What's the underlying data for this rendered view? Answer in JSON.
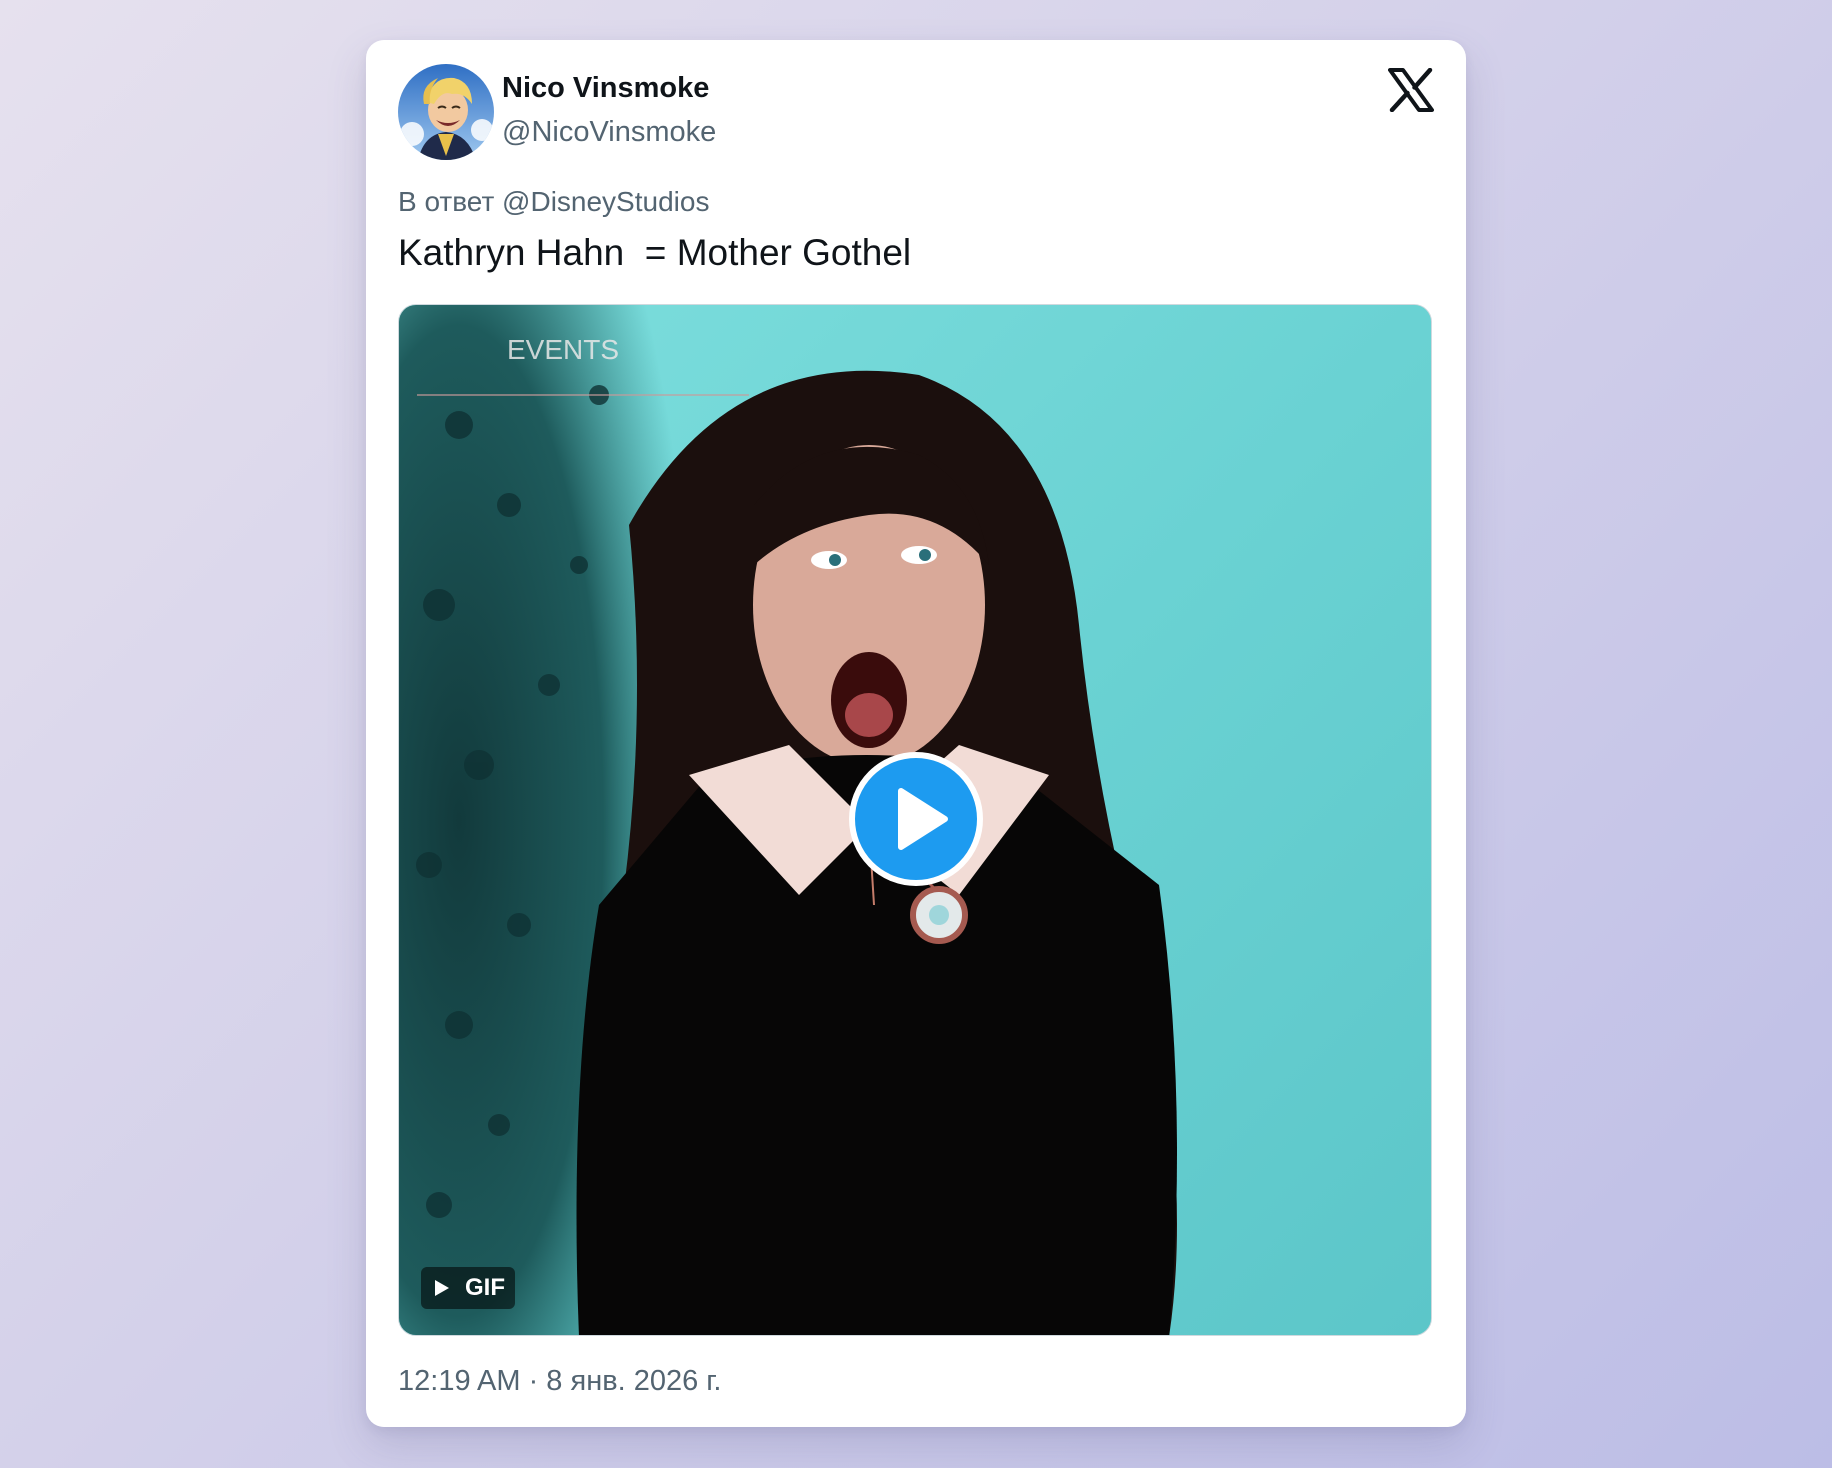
{
  "author": {
    "name": "Nico Vinsmoke",
    "handle": "@NicoVinsmoke",
    "avatar_icon": "anime-character-avatar"
  },
  "brand": {
    "logo_icon": "x-logo-icon"
  },
  "reply": {
    "prefix": "В ответ",
    "mention": "@DisneyStudios"
  },
  "tweet": {
    "text": "Kathryn Hahn  = Mother Gothel"
  },
  "media": {
    "badge_label": "GIF",
    "play_icon": "play-icon",
    "watermark": "EVENTS"
  },
  "meta": {
    "timestamp": "12:19 AM · 8 янв. 2026 г."
  },
  "colors": {
    "accent": "#1d9bf0",
    "text_primary": "#0f1419",
    "text_secondary": "#536471"
  }
}
